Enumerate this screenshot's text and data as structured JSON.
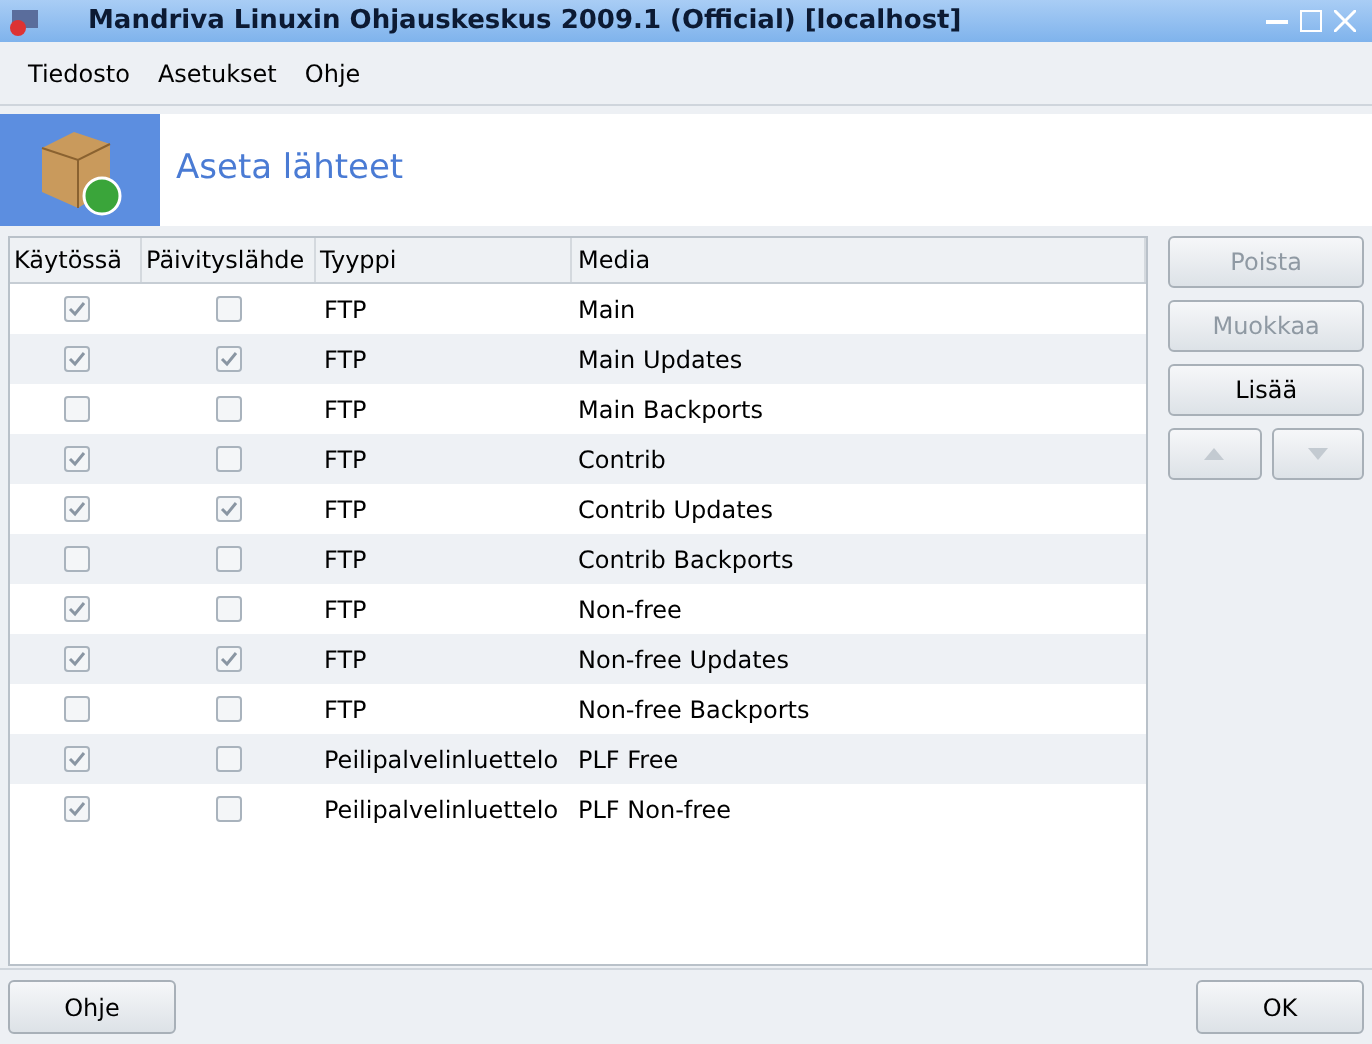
{
  "window": {
    "title": "Mandriva Linuxin Ohjauskeskus 2009.1 (Official) [localhost]"
  },
  "menu": [
    "Tiedosto",
    "Asetukset",
    "Ohje"
  ],
  "banner": {
    "title": "Aseta lähteet"
  },
  "table": {
    "columns": [
      "Käytössä",
      "Päivityslähde",
      "Tyyppi",
      "Media"
    ],
    "rows": [
      {
        "enabled": true,
        "update": false,
        "type": "FTP",
        "media": "Main"
      },
      {
        "enabled": true,
        "update": true,
        "type": "FTP",
        "media": "Main Updates"
      },
      {
        "enabled": false,
        "update": false,
        "type": "FTP",
        "media": "Main Backports"
      },
      {
        "enabled": true,
        "update": false,
        "type": "FTP",
        "media": "Contrib"
      },
      {
        "enabled": true,
        "update": true,
        "type": "FTP",
        "media": "Contrib Updates"
      },
      {
        "enabled": false,
        "update": false,
        "type": "FTP",
        "media": "Contrib Backports"
      },
      {
        "enabled": true,
        "update": false,
        "type": "FTP",
        "media": "Non-free"
      },
      {
        "enabled": true,
        "update": true,
        "type": "FTP",
        "media": "Non-free Updates"
      },
      {
        "enabled": false,
        "update": false,
        "type": "FTP",
        "media": "Non-free Backports"
      },
      {
        "enabled": true,
        "update": false,
        "type": "Peilipalvelinluettelo",
        "media": "PLF Free"
      },
      {
        "enabled": true,
        "update": false,
        "type": "Peilipalvelinluettelo",
        "media": "PLF Non-free"
      }
    ]
  },
  "side_buttons": [
    {
      "label": "Poista",
      "disabled": true
    },
    {
      "label": "Muokkaa",
      "disabled": true
    },
    {
      "label": "Lisää",
      "disabled": false
    }
  ],
  "move_buttons": [
    {
      "kind": "up",
      "disabled": true
    },
    {
      "kind": "down",
      "disabled": true
    }
  ],
  "footer": {
    "help": "Ohje",
    "ok": "OK"
  }
}
